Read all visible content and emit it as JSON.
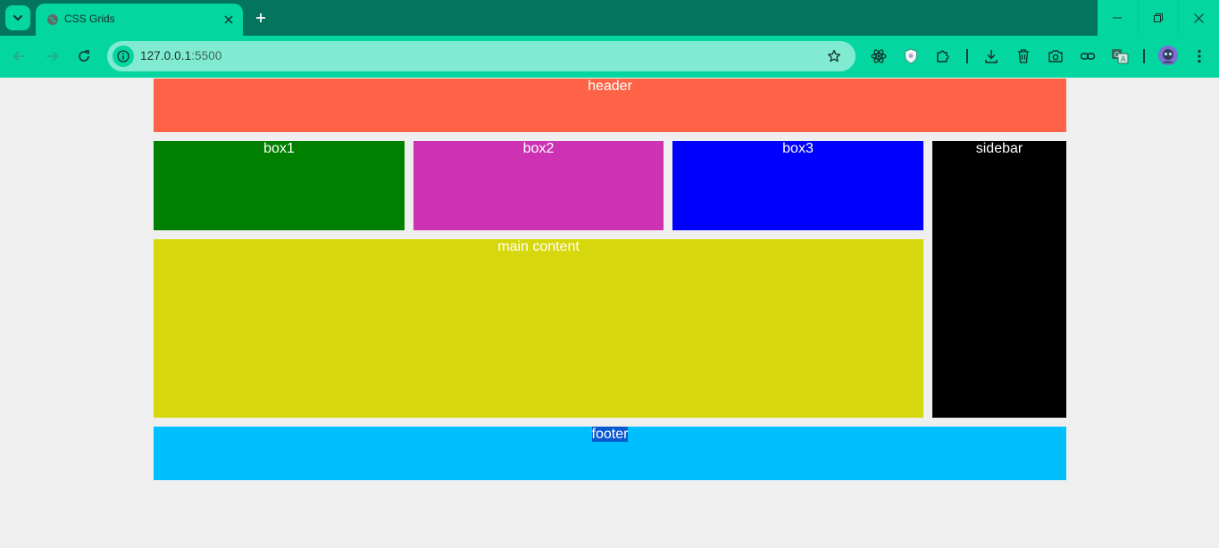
{
  "browser": {
    "tab": {
      "title": "CSS Grids"
    },
    "url": {
      "host": "127.0.0.1",
      "port": ":5500"
    },
    "icons": {
      "tab_search": "chevron-down-icon",
      "favicon": "globe-icon",
      "tab_close": "close-icon",
      "new_tab": "plus-icon",
      "back": "arrow-left-icon",
      "forward": "arrow-right-icon",
      "reload": "reload-icon",
      "site_info": "info-icon",
      "bookmark": "star-icon",
      "extensions": [
        "react-icon",
        "shield-icon",
        "puzzle-icon",
        "download-icon",
        "trash-icon",
        "camera-icon",
        "link-icon",
        "translate-icon"
      ],
      "menu": "kebab-menu-icon"
    }
  },
  "page": {
    "header": "header",
    "box1": "box1",
    "box2": "box2",
    "box3": "box3",
    "sidebar": "sidebar",
    "main": "main content",
    "footer": "footer"
  },
  "colors": {
    "chrome_dark": "#04755d",
    "chrome_accent": "#03d79f",
    "header": "#ff6347",
    "box1": "#008000",
    "box2": "#cd32b4",
    "box3": "#0000ff",
    "sidebar": "#000000",
    "main": "#d7d70d",
    "footer": "#00bfff"
  }
}
